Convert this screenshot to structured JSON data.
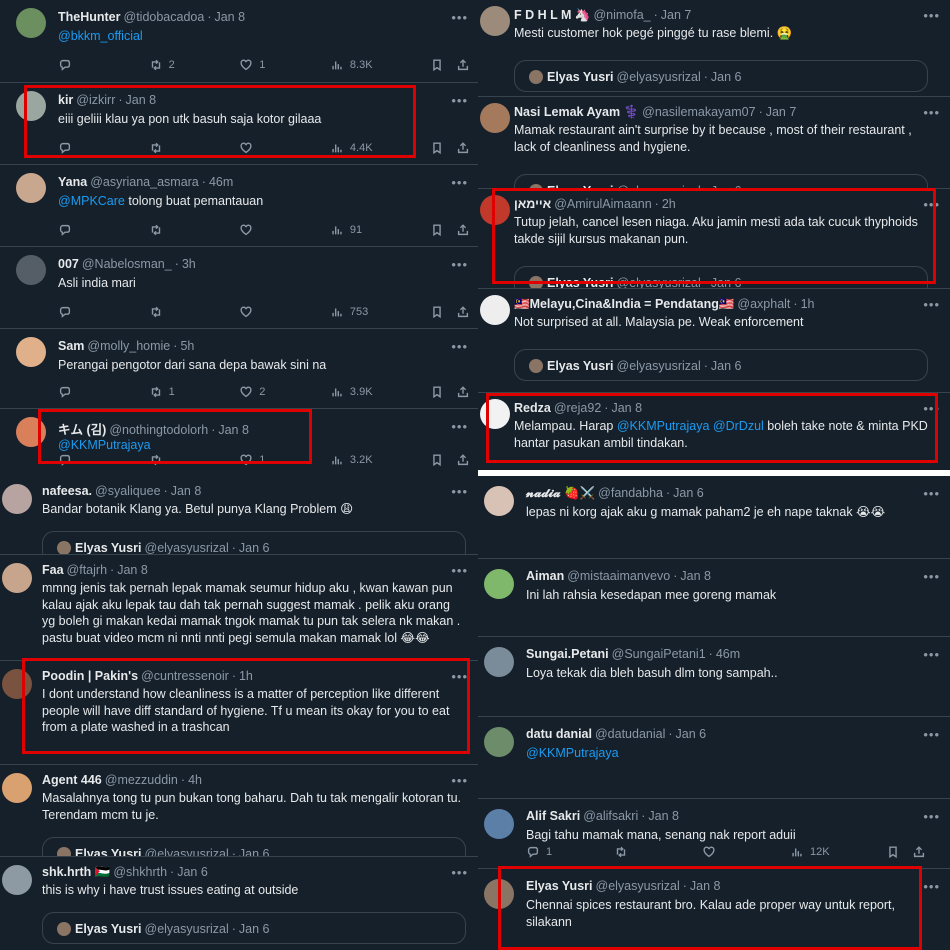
{
  "left_top": [
    {
      "name": "TheHunter",
      "handle": "@tidobacadoa",
      "date": "Jan 8",
      "mention": "@bkkm_official",
      "text": "",
      "replies": "",
      "retweets": "2",
      "likes": "1",
      "views": "8.3K",
      "av": "#6b8f5e",
      "av_letter": ""
    },
    {
      "name": "kir",
      "handle": "@izkirr",
      "date": "Jan 8",
      "mention": "",
      "text": "eiii geliii klau ya pon utk basuh saja kotor gilaaa",
      "replies": "",
      "retweets": "",
      "likes": "",
      "views": "4.4K",
      "av": "#9aa7a0",
      "av_letter": ""
    },
    {
      "name": "Yana",
      "handle": "@asyriana_asmara",
      "date": "46m",
      "mention": "@MPKCare",
      "text": " tolong buat pemantauan",
      "replies": "",
      "retweets": "",
      "likes": "",
      "views": "91",
      "av": "#c9a78e",
      "av_letter": ""
    },
    {
      "name": "007",
      "handle": "@Nabelosman_",
      "date": "3h",
      "mention": "",
      "text": "Asli india mari",
      "replies": "",
      "retweets": "",
      "likes": "",
      "views": "753",
      "av": "#555e66",
      "av_letter": ""
    },
    {
      "name": "Sam",
      "handle": "@molly_homie",
      "date": "5h",
      "mention": "",
      "text": "Perangai pengotor dari sana depa bawak sini na",
      "replies": "",
      "retweets": "1",
      "likes": "2",
      "views": "3.9K",
      "av": "#e0b08a",
      "av_letter": ""
    },
    {
      "name": "キム (김)",
      "handle": "@nothingtodolorh",
      "date": "Jan 8",
      "mention": "@KKMPutrajaya",
      "text": "",
      "replies": "",
      "retweets": "",
      "likes": "1",
      "views": "3.2K",
      "av": "#d9805a",
      "av_letter": ""
    }
  ],
  "left_bottom": [
    {
      "name": "nafeesa.",
      "handle": "@syaliquee",
      "date": "Jan 8",
      "text": "Bandar botanik Klang ya. Betul punya Klang Problem 😩",
      "quote": true,
      "av": "#b7a3a0"
    },
    {
      "name": "Faa",
      "handle": "@ftajrh",
      "date": "Jan 8",
      "text": "mmng jenis tak pernah lepak mamak seumur hidup aku , kwan kawan pun kalau ajak aku lepak tau dah tak pernah suggest mamak . pelik aku orang yg boleh gi makan kedai mamak tngok mamak tu pun tak selera nk makan . pastu buat video mcm ni nnti nnti pegi semula makan mamak lol 😂😂",
      "quote": false,
      "av": "#c7a58c"
    },
    {
      "name": "Poodin | Pakin's",
      "handle": "@cuntressenoir",
      "date": "1h",
      "text": "I dont understand how cleanliness is a matter of perception like different people will have diff standard of hygiene. Tf u mean its okay for you to eat from a plate washed in a trashcan",
      "quote": false,
      "av": "#7a5240"
    },
    {
      "name": "Agent 446",
      "handle": "@mezzuddin",
      "date": "4h",
      "text": "Masalahnya tong tu pun bukan tong baharu. Dah tu tak mengalir kotoran tu. Terendam mcm tu je.",
      "quote": true,
      "av": "#d9a070"
    },
    {
      "name": "shk.hrth 🇵🇸",
      "handle": "@shkhrth",
      "date": "Jan 6",
      "text": "this is why i have trust issues eating at outside",
      "quote": true,
      "av": "#8e9aa3"
    }
  ],
  "right_top": [
    {
      "name": "F D H L M 🦄",
      "handle": "@nimofa_",
      "date": "Jan 7",
      "text": "Mesti customer hok pegé pinggé tu rase blemi. 🤮",
      "quote": true,
      "av": "#9c8b7a"
    },
    {
      "name": "Nasi Lemak Ayam ⚕️",
      "handle": "@nasilemakayam07",
      "date": "Jan 7",
      "text": "Mamak restaurant ain't surprise by it because , most of their restaurant , lack of cleanliness and hygiene.",
      "quote": true,
      "av": "#a57a5c"
    },
    {
      "name": "איימאן",
      "handle": "@AmirulAimaann",
      "date": "2h",
      "text": "Tutup jelah, cancel lesen niaga. Aku jamin mesti ada tak cucuk thyphoids takde sijil kursus makanan pun.",
      "quote": true,
      "av": "#c0392b"
    },
    {
      "name": "🇲🇾Melayu,Cina&India = Pendatang🇲🇾",
      "handle": "@axphalt",
      "date": "1h",
      "text": "Not surprised at all. Malaysia pe. Weak enforcement",
      "quote": true,
      "av": "#eeeeee"
    },
    {
      "name": "Redza",
      "handle": "@reja92",
      "date": "Jan 8",
      "text": "Melampau. Harap",
      "mention1": "@KKMPutrajaya",
      "mention2": "@DrDzul",
      "text2": "boleh take note & minta PKD hantar pasukan ambil tindakan.",
      "quote": false,
      "av": "#f2f2f2"
    }
  ],
  "right_bottom": [
    {
      "name": "𝓷𝓪𝓭𝓲𝓪 🍓⚔️",
      "handle": "@fandabha",
      "date": "Jan 6",
      "text": "lepas ni korg ajak aku g mamak paham2 je eh nape taknak 😭😭",
      "quote": true,
      "av": "#d8c2b5"
    },
    {
      "name": "Aiman",
      "handle": "@mistaaimanvevo",
      "date": "Jan 8",
      "text": "Ini lah rahsia kesedapan mee goreng mamak",
      "quote": true,
      "av": "#7fb86a"
    },
    {
      "name": "Sungai.Petani",
      "handle": "@SungaiPetani1",
      "date": "46m",
      "text": "Loya tekak dia bleh basuh dlm tong sampah..",
      "quote": true,
      "av": "#7a8c9a"
    },
    {
      "name": "datu danial",
      "handle": "@datudanial",
      "date": "Jan 6",
      "mention": "@KKMPutrajaya",
      "text": "",
      "quote": true,
      "av": "#6d8c6a"
    },
    {
      "name": "Alif Sakri",
      "handle": "@alifsakri",
      "date": "Jan 8",
      "text": "Bagi tahu mamak mana, senang nak report aduii",
      "quote": false,
      "replies": "1",
      "views": "12K",
      "av": "#5c7fa8"
    },
    {
      "name": "Elyas Yusri",
      "handle": "@elyasyusrizal",
      "date": "Jan 8",
      "text": "Chennai spices restaurant bro. Kalau ade proper way untuk report, silakann",
      "quote": false,
      "av": "#8a7565"
    }
  ],
  "quote_label": {
    "name": "Elyas Yusri",
    "handle": "@elyasyusrizal",
    "date": "Jan 6"
  },
  "colors": {
    "bg": "#15202b",
    "text": "#e7e9ea",
    "muted": "#8b98a5",
    "link": "#1d9bf0",
    "border": "#38444d",
    "highlight": "#e00000"
  }
}
